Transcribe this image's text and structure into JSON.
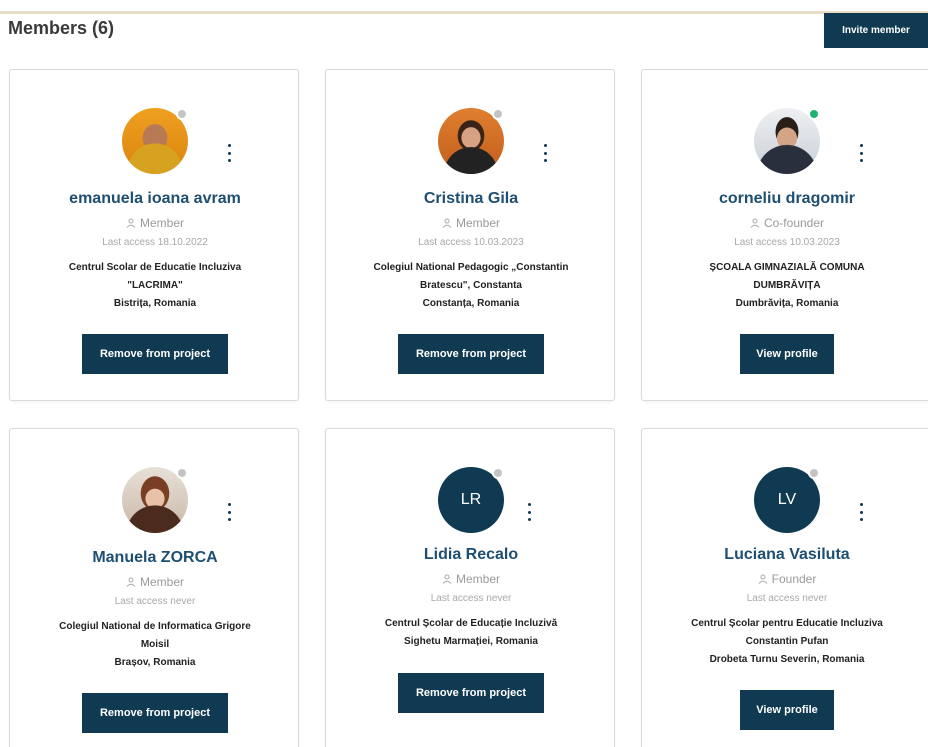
{
  "header": {
    "title": "Members (6)",
    "invite_label": "Invite member"
  },
  "members": [
    {
      "name": "emanuela ioana avram",
      "role": "Member",
      "last_access": "Last access 18.10.2022",
      "org_line1": "Centrul Scolar de Educatie Incluziva",
      "org_line2": "\"LACRIMA\"",
      "location": "Bistrița, Romania",
      "status": "offline",
      "action_label": "Remove from project"
    },
    {
      "name": "Cristina Gila",
      "role": "Member",
      "last_access": "Last access 10.03.2023",
      "org_line1": "Colegiul National Pedagogic „Constantin",
      "org_line2": "Bratescu\", Constanta",
      "location": "Constanța, Romania",
      "status": "offline",
      "action_label": "Remove from project"
    },
    {
      "name": "corneliu dragomir",
      "role": "Co-founder",
      "last_access": "Last access 10.03.2023",
      "org_line1": "ȘCOALA GIMNAZIALĂ COMUNA",
      "org_line2": "DUMBRĂVIȚA",
      "location": "Dumbrăvița, Romania",
      "status": "online",
      "action_label": "View profile"
    },
    {
      "name": "Manuela ZORCA",
      "role": "Member",
      "last_access": "Last access never",
      "org_line1": "Colegiul National de Informatica Grigore",
      "org_line2": "Moisil",
      "location": "Brașov, Romania",
      "status": "offline",
      "action_label": "Remove from project"
    },
    {
      "name": "Lidia Recalo",
      "initials": "LR",
      "role": "Member",
      "last_access": "Last access never",
      "org_line1": "Centrul Școlar de Educație Incluzivă",
      "org_line2": "Sighetu Marmației, Romania",
      "status": "offline",
      "action_label": "Remove from project"
    },
    {
      "name": "Luciana Vasiluta",
      "initials": "LV",
      "role": "Founder",
      "last_access": "Last access never",
      "org_line1": "Centrul Școlar pentru Educatie Incluziva",
      "org_line2": "Constantin Pufan",
      "location": "Drobeta Turnu Severin, Romania",
      "status": "offline",
      "action_label": "View profile"
    }
  ],
  "colors": {
    "primary": "#0f3a52",
    "name": "#1e4f73",
    "online": "#20b070",
    "offline": "#c4c4c4"
  },
  "icons": {
    "kebab": "more-vertical-icon",
    "role": "user-icon"
  }
}
